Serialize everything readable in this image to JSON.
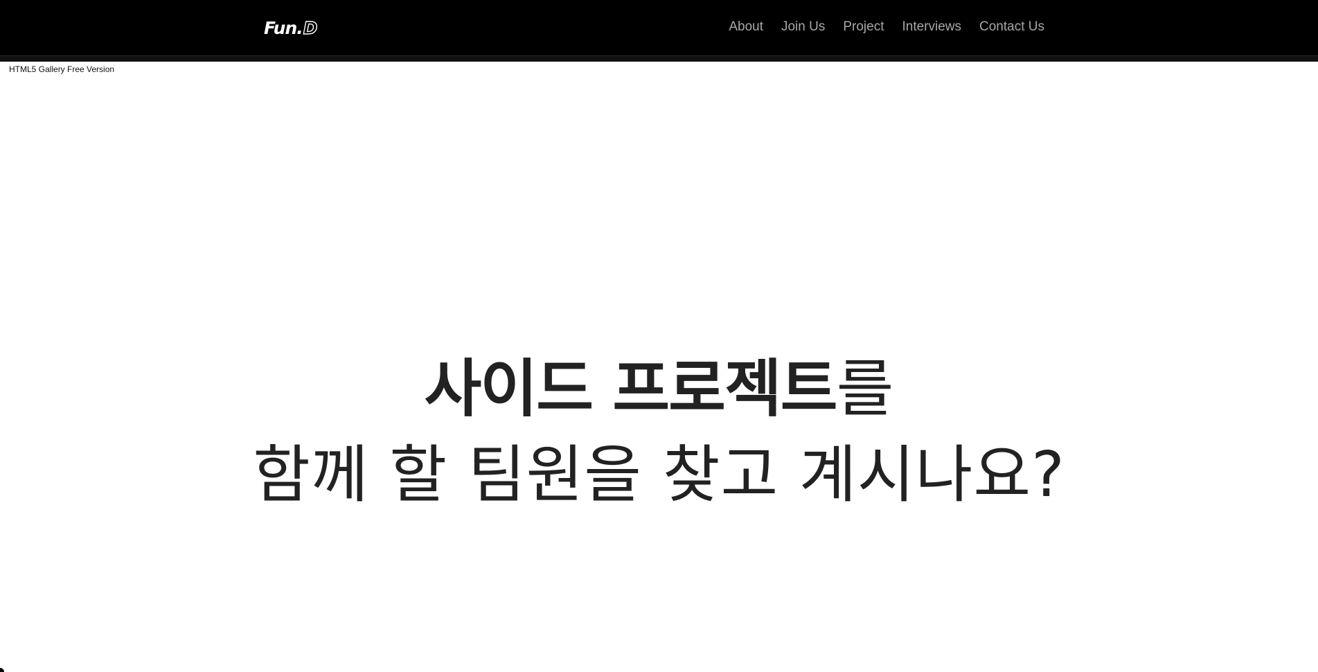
{
  "header": {
    "logo": {
      "text": "Fun.",
      "accent": "D"
    },
    "nav": [
      {
        "label": "About"
      },
      {
        "label": "Join Us"
      },
      {
        "label": "Project"
      },
      {
        "label": "Interviews"
      },
      {
        "label": "Contact Us"
      }
    ]
  },
  "gallery_note": "HTML5 Gallery Free Version",
  "hero": {
    "line1_bold": "사이드 프로젝트",
    "line1_regular": "를",
    "line2": "함께 할 팀원을 찾고 계시나요?"
  },
  "colors": {
    "header_bg": "#000000",
    "nav_text": "#a8a8a8",
    "hero_text": "#222222",
    "page_bg": "#ffffff"
  }
}
